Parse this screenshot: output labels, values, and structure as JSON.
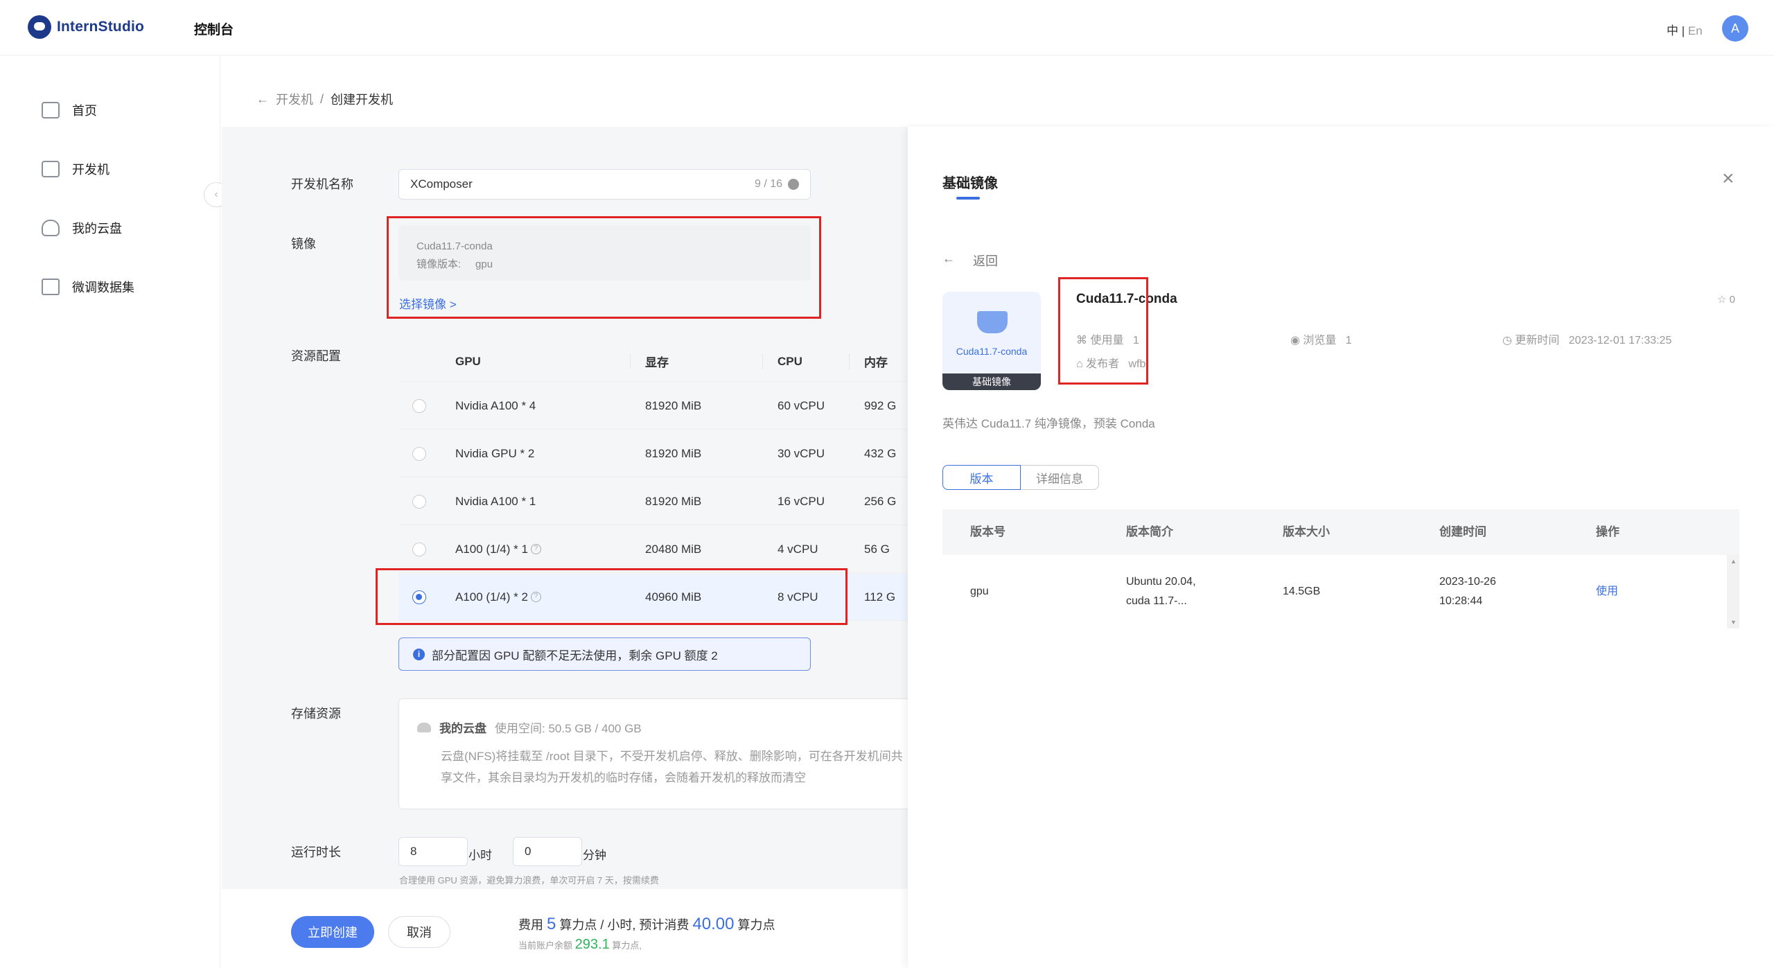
{
  "header": {
    "brand": "InternStudio",
    "nav": "控制台",
    "lang_zh": "中",
    "lang_sep": "|",
    "lang_en": "En",
    "avatar": "A"
  },
  "sidebar": {
    "items": [
      {
        "label": "首页",
        "icon": "home-icon"
      },
      {
        "label": "开发机",
        "icon": "terminal-icon"
      },
      {
        "label": "我的云盘",
        "icon": "cloud-icon"
      },
      {
        "label": "微调数据集",
        "icon": "dataset-icon"
      }
    ]
  },
  "breadcrumb": {
    "back_arrow": "←",
    "parent": "开发机",
    "sep": "/",
    "current": "创建开发机"
  },
  "form": {
    "name_label": "开发机名称",
    "name_value": "XComposer",
    "name_count": "9 / 16",
    "image_label": "镜像",
    "image_name": "Cuda11.7-conda",
    "image_version_label": "镜像版本:",
    "image_version_value": "gpu",
    "select_image": "选择镜像 >",
    "resource_label": "资源配置",
    "resource_headers": {
      "gpu": "GPU",
      "mem": "显存",
      "cpu": "CPU",
      "ram": "内存"
    },
    "resources": [
      {
        "gpu": "Nvidia A100 * 4",
        "mem": "81920 MiB",
        "cpu": "60 vCPU",
        "ram": "992 G",
        "help": false,
        "selected": false
      },
      {
        "gpu": "Nvidia GPU * 2",
        "mem": "81920 MiB",
        "cpu": "30 vCPU",
        "ram": "432 G",
        "help": false,
        "selected": false
      },
      {
        "gpu": "Nvidia A100 * 1",
        "mem": "81920 MiB",
        "cpu": "16 vCPU",
        "ram": "256 G",
        "help": false,
        "selected": false
      },
      {
        "gpu": "A100 (1/4) * 1",
        "mem": "20480 MiB",
        "cpu": "4 vCPU",
        "ram": "56 G",
        "help": true,
        "selected": false
      },
      {
        "gpu": "A100 (1/4) * 2",
        "mem": "40960 MiB",
        "cpu": "8 vCPU",
        "ram": "112 G",
        "help": true,
        "selected": true
      }
    ],
    "help_glyph": "?",
    "notice_icon": "i",
    "notice": "部分配置因 GPU 配额不足无法使用，剩余 GPU 额度 2",
    "storage_label": "存储资源",
    "storage_title": "我的云盘",
    "storage_usage": "使用空间: 50.5 GB / 400 GB",
    "storage_desc": "云盘(NFS)将挂载至 /root 目录下，不受开发机启停、释放、删除影响，可在各开发机间共享文件，其余目录均为开发机的临时存储，会随着开发机的释放而清空",
    "duration_label": "运行时长",
    "hours": "8",
    "hours_unit": "小时",
    "minutes": "0",
    "minutes_unit": "分钟",
    "duration_hint": "合理使用 GPU 资源，避免算力浪费，单次可开启 7 天，按需续费"
  },
  "footer": {
    "create": "立即创建",
    "cancel": "取消",
    "fee_label": "费用",
    "fee_rate": "5",
    "fee_rate_unit": "算力点 / 小时, 预计消费",
    "fee_total": "40.00",
    "fee_total_unit": "算力点",
    "balance_label": "当前账户余额",
    "balance": "293.1",
    "balance_unit": "算力点,"
  },
  "drawer": {
    "title": "基础镜像",
    "close": "×",
    "back_arrow": "←",
    "back": "返回",
    "card_name": "Cuda11.7-conda",
    "card_tag": "基础镜像",
    "image_name": "Cuda11.7-conda",
    "usage_label": "使用量",
    "usage": "1",
    "views_label": "浏览量",
    "views": "1",
    "updated_label": "更新时间",
    "updated": "2023-12-01 17:33:25",
    "publisher_label": "发布者",
    "publisher": "wfbi",
    "star_count": "0",
    "description": "英伟达 Cuda11.7 纯净镜像，预装 Conda",
    "tabs": [
      "版本",
      "详细信息"
    ],
    "version_headers": [
      "版本号",
      "版本简介",
      "版本大小",
      "创建时间",
      "操作"
    ],
    "versions": [
      {
        "id": "gpu",
        "intro_line1": "Ubuntu 20.04,",
        "intro_line2": "cuda 11.7-...",
        "size": "14.5GB",
        "date": "2023-10-26",
        "time": "10:28:44",
        "action": "使用"
      }
    ]
  }
}
